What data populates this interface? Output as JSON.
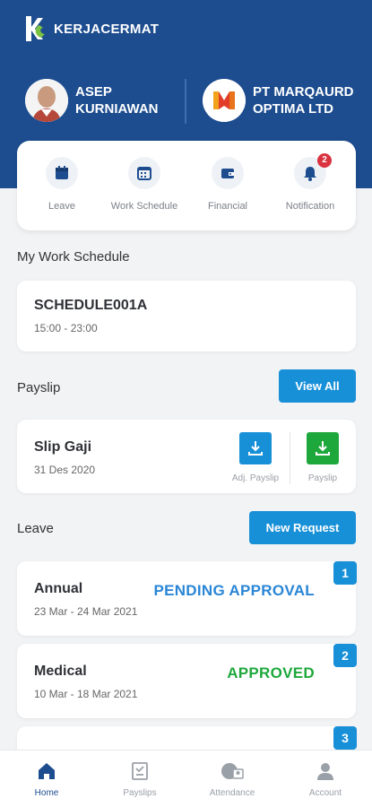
{
  "brand": {
    "name": "KERJACERMAT"
  },
  "user": {
    "name": "ASEP KURNIAWAN"
  },
  "company": {
    "name": "PT MARQAURD OPTIMA LTD"
  },
  "menu": [
    {
      "label": "Leave",
      "icon": "calendar-icon"
    },
    {
      "label": "Work Schedule",
      "icon": "schedule-icon"
    },
    {
      "label": "Financial",
      "icon": "wallet-icon"
    },
    {
      "label": "Notification",
      "icon": "bell-icon",
      "badge": "2"
    }
  ],
  "work_schedule": {
    "title": "My Work Schedule",
    "code": "SCHEDULE001A",
    "time": "15:00 - 23:00"
  },
  "payslip": {
    "title": "Payslip",
    "view_all": "View All",
    "item_title": "Slip Gaji",
    "item_date": "31 Des 2020",
    "adj_label": "Adj. Payslip",
    "payslip_label": "Payslip"
  },
  "leave": {
    "title": "Leave",
    "new_request": "New Request",
    "items": [
      {
        "num": "1",
        "type": "Annual",
        "dates": "23 Mar - 24 Mar 2021",
        "status": "PENDING APPROVAL"
      },
      {
        "num": "2",
        "type": "Medical",
        "dates": "10 Mar - 18 Mar 2021",
        "status": "APPROVED"
      },
      {
        "num": "3"
      }
    ]
  },
  "bottom_nav": [
    {
      "label": "Home",
      "icon": "home-icon",
      "active": true
    },
    {
      "label": "Payslips",
      "icon": "payslip-icon"
    },
    {
      "label": "Attendance",
      "icon": "attendance-icon"
    },
    {
      "label": "Account",
      "icon": "account-icon"
    }
  ],
  "colors": {
    "header": "#1d4d8f",
    "accent": "#1890d8",
    "pending": "#2a86d6",
    "approved": "#1ea83c",
    "download_green": "#1ea83c",
    "badge": "#d9333f"
  }
}
